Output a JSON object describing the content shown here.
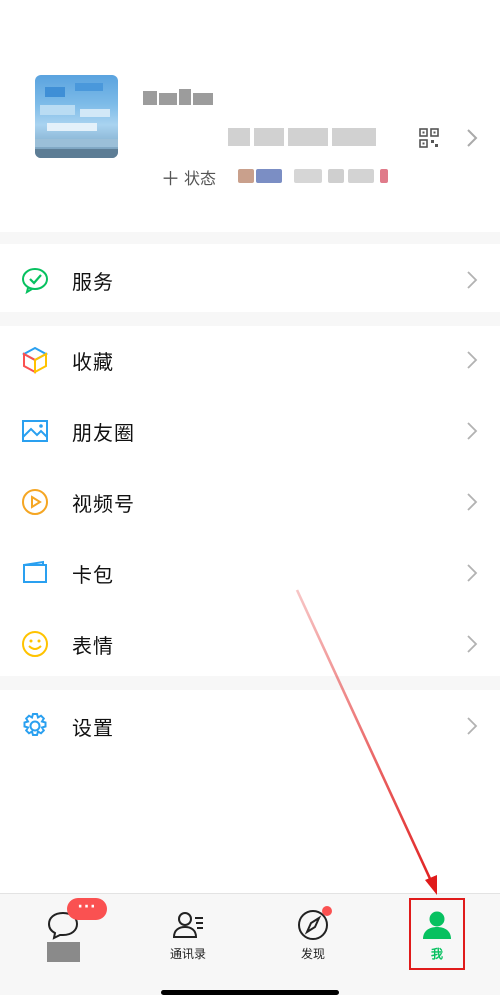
{
  "profile": {
    "status_label": "状态",
    "status_plus": "＋"
  },
  "menu": {
    "services": "服务",
    "favorites": "收藏",
    "moments": "朋友圈",
    "channels": "视频号",
    "cards": "卡包",
    "stickers": "表情",
    "settings": "设置"
  },
  "tabbar": {
    "chats_badge": "···",
    "contacts": "通讯录",
    "discover": "发现",
    "me": "我"
  },
  "colors": {
    "brand_green": "#07c160",
    "badge_red": "#fa5151",
    "annotation_red": "#e01b1b",
    "tabbar_bg": "#f7f7f7"
  }
}
